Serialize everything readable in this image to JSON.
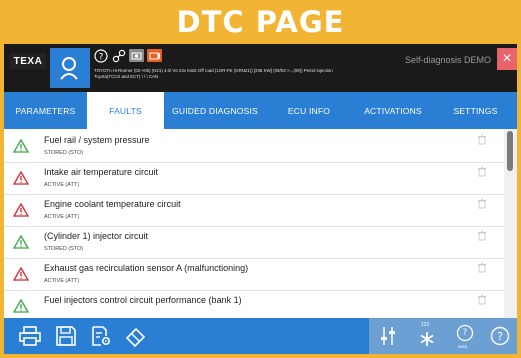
{
  "banner": {
    "title": "DTC PAGE"
  },
  "topbar": {
    "logo": "TEXA",
    "vehicle_line1": "TOYOTA Hi-Runner (02->05) (N21) 4.0i V6 24v KatS Off road (1GR-FE (GRN21)) [236 KW] (08/02->...(09)) Petrol injection",
    "vehicle_line2": "Toyota(TCCS and ECT) \\ \\ \\ CAN",
    "right_label": "Self-diagnosis DEMO",
    "close_symbol": "×"
  },
  "tabs": [
    {
      "label": "PARAMETERS"
    },
    {
      "label": "FAULTS"
    },
    {
      "label": "GUIDED DIAGNOSIS"
    },
    {
      "label": "ECU INFO"
    },
    {
      "label": "ACTIVATIONS"
    },
    {
      "label": "SETTINGS"
    }
  ],
  "active_tab": "FAULTS",
  "faults": [
    {
      "title": "Fuel rail / system pressure",
      "status": "STORED (STO)",
      "severity": "stored",
      "color": "#3aa648"
    },
    {
      "title": "Intake air temperature circuit",
      "status": "ACTIVE (ATT)",
      "severity": "active",
      "color": "#d8262d"
    },
    {
      "title": "Engine coolant temperature circuit",
      "status": "ACTIVE (ATT)",
      "severity": "active",
      "color": "#d8262d"
    },
    {
      "title": "(Cylinder 1) injector circuit",
      "status": "STORED (STO)",
      "severity": "stored",
      "color": "#3aa648"
    },
    {
      "title": "Exhaust gas recirculation sensor A (malfunctioning)",
      "status": "ACTIVE (ATT)",
      "severity": "active",
      "color": "#d8262d"
    },
    {
      "title": "Fuel injectors control circuit performance (bank 1)",
      "status": "",
      "severity": "stored",
      "color": "#3aa648"
    }
  ],
  "bottombar": {
    "icons": [
      "printer-icon",
      "save-icon",
      "report-settings-icon",
      "erase-icon",
      "tune-icon",
      "numeric-keypad-icon",
      "web-help-icon",
      "help-icon"
    ],
    "keypad_label": "123",
    "web_label": "WEB"
  },
  "colors": {
    "accent": "#2a7fd4",
    "banner": "#f2b533",
    "active_fault": "#d8262d",
    "stored_fault": "#3aa648"
  }
}
